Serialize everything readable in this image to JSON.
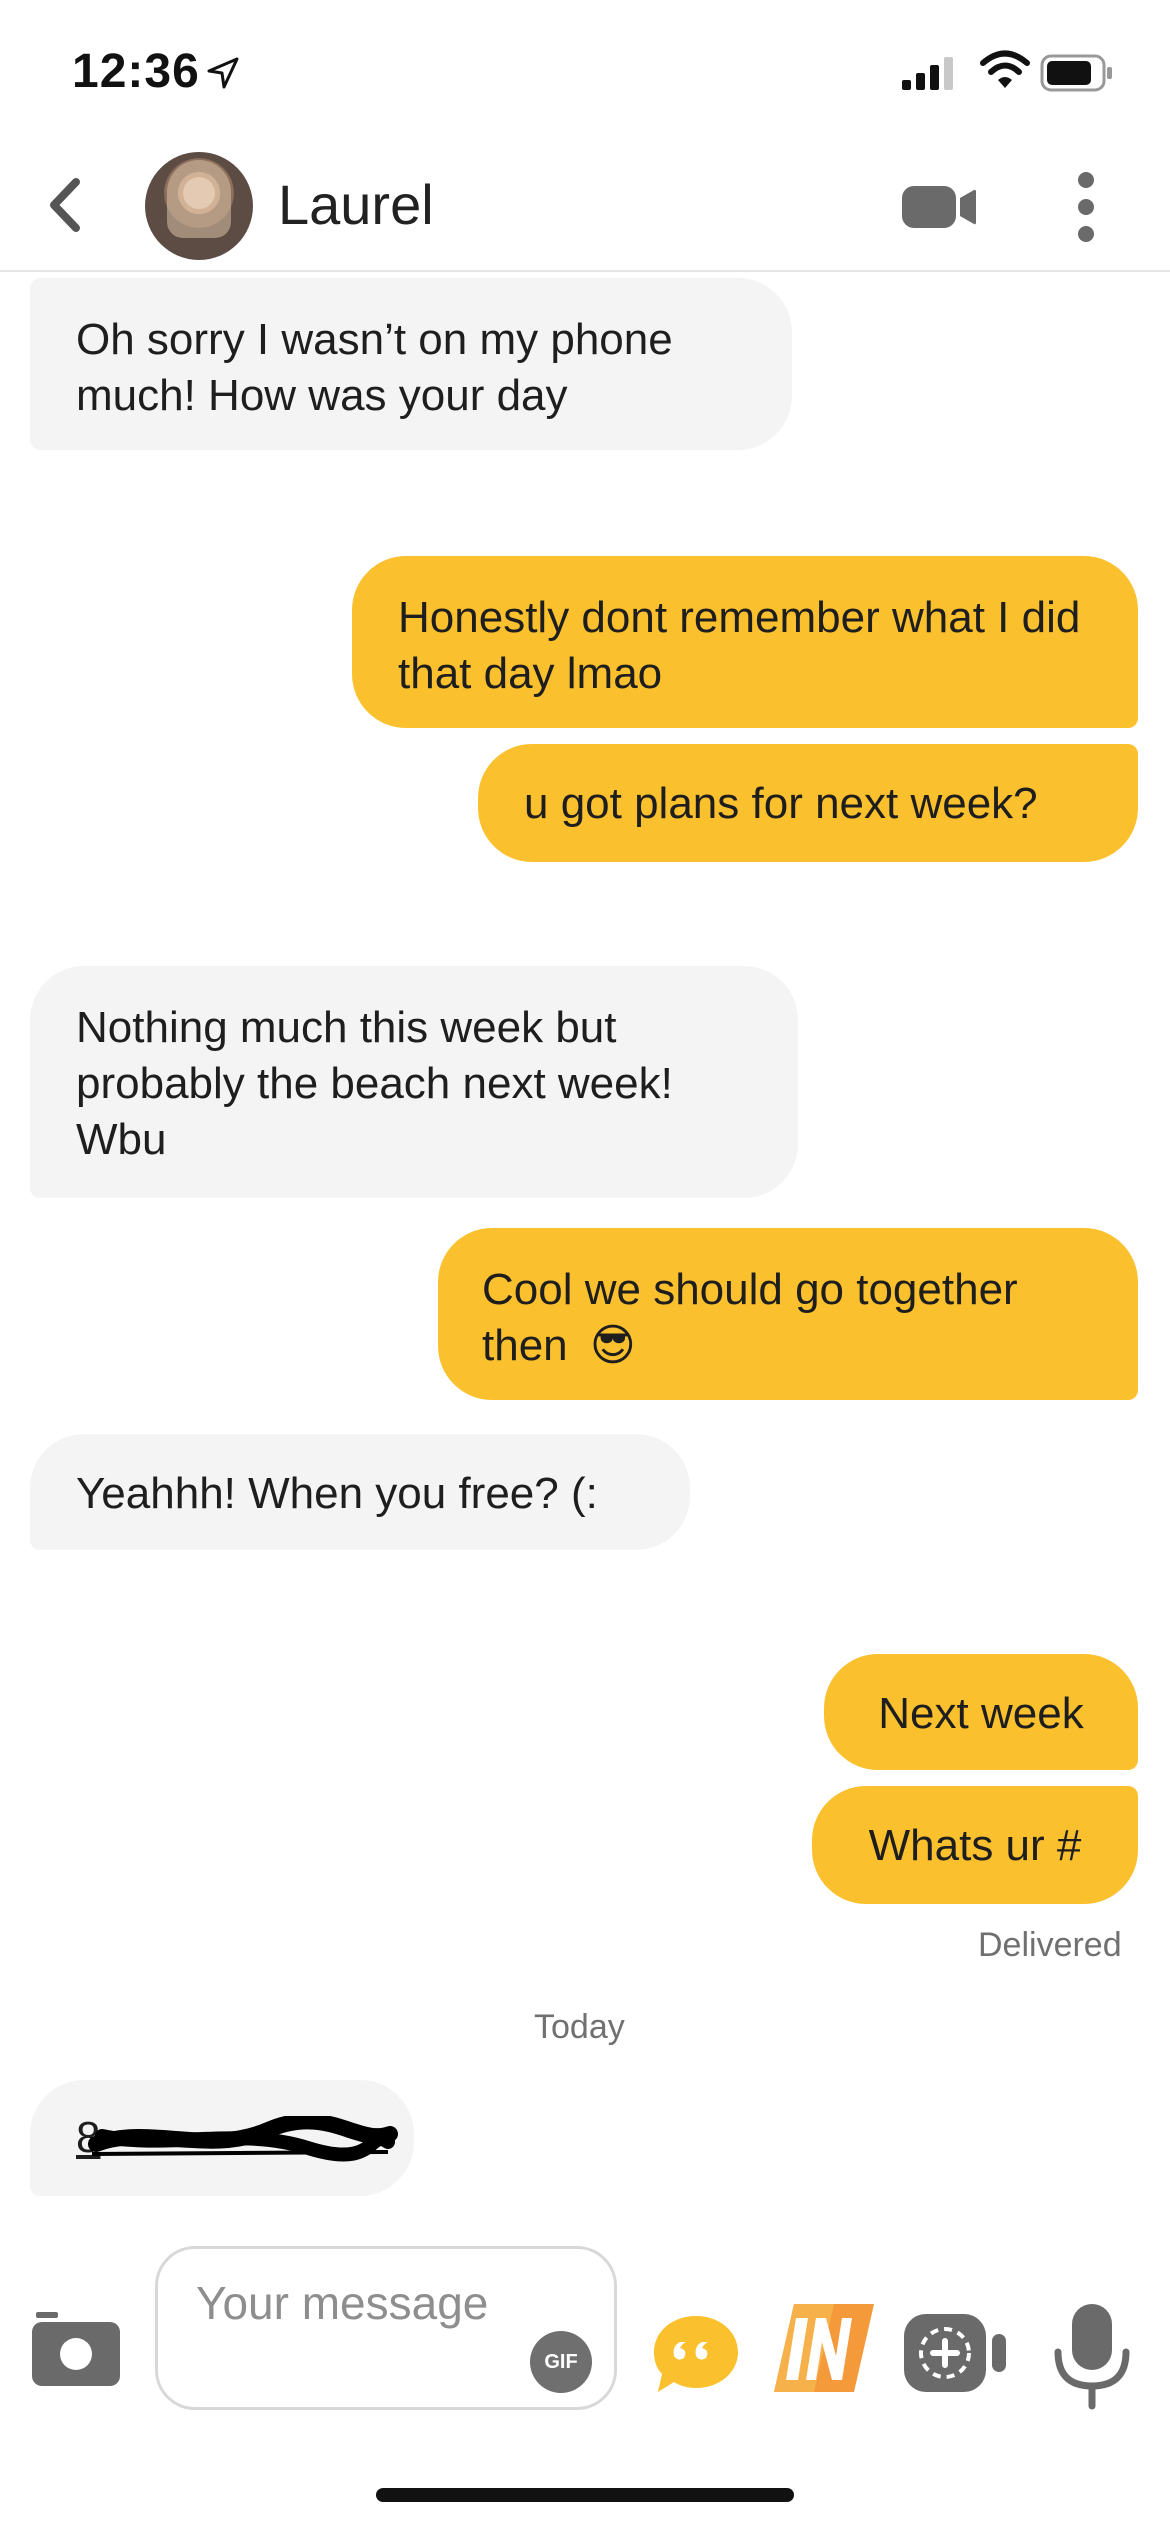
{
  "status_bar": {
    "time": "12:36"
  },
  "header": {
    "contact_name": "Laurel"
  },
  "messages": [
    {
      "side": "in",
      "text": "Oh sorry I wasn’t on my phone much! How was your day"
    },
    {
      "side": "out",
      "text": "Honestly dont remember what I did that day lmao"
    },
    {
      "side": "out",
      "text": "u got plans for next week?"
    },
    {
      "side": "in",
      "text": "Nothing much this week but probably the beach next week! Wbu"
    },
    {
      "side": "out",
      "text": "Cool we should go together then",
      "emoji": "😎"
    },
    {
      "side": "in",
      "text": "Yeahhh! When you free? (:"
    },
    {
      "side": "out",
      "text": "Next week"
    },
    {
      "side": "out",
      "text": "Whats ur #"
    },
    {
      "side": "in",
      "text": "8",
      "redacted": true
    }
  ],
  "delivered_label": "Delivered",
  "date_divider": "Today",
  "composer": {
    "placeholder": "Your message",
    "gif_label": "GIF"
  },
  "colors": {
    "outgoing": "#fbc02d",
    "incoming": "#f4f4f4"
  },
  "icons": [
    "location-arrow-icon",
    "signal-icon",
    "wifi-icon",
    "battery-icon",
    "back-chevron-icon",
    "video-call-icon",
    "more-options-icon",
    "camera-icon",
    "gif-icon",
    "quote-icon",
    "in-badge-icon",
    "add-video-icon",
    "microphone-icon"
  ]
}
